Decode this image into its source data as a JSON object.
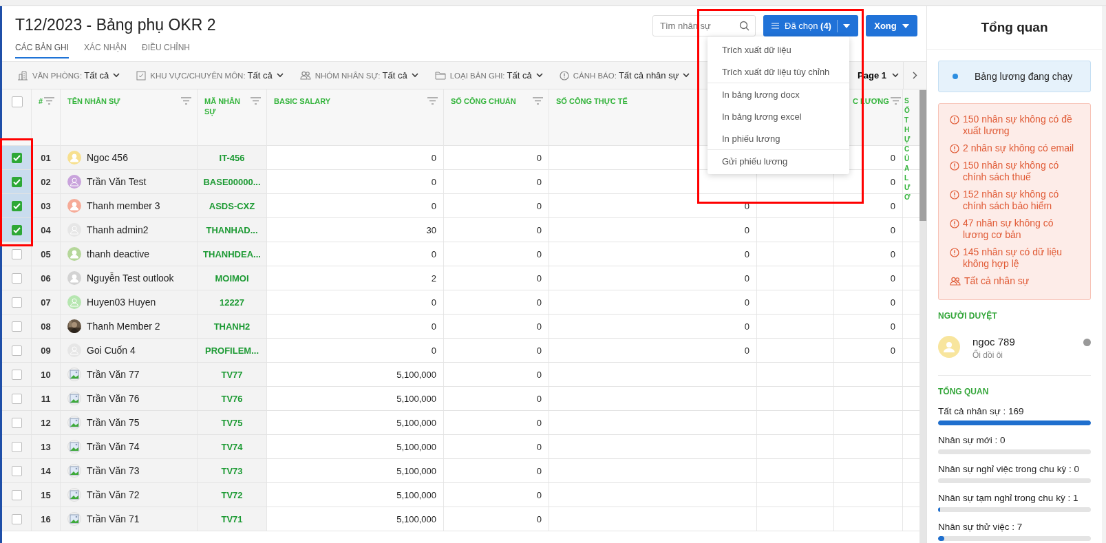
{
  "page": {
    "title": "T12/2023 - Bảng phụ OKR 2",
    "tabs": [
      {
        "label": "CÁC BẢN GHI",
        "selected": true
      },
      {
        "label": "XÁC NHẬN",
        "selected": false
      },
      {
        "label": "ĐIỀU CHỈNH",
        "selected": false
      }
    ]
  },
  "search": {
    "placeholder": "Tìm nhân sự"
  },
  "selected_button": {
    "label": "Đã chọn",
    "count": "(4)"
  },
  "done_button": {
    "label": "Xong"
  },
  "menu": {
    "groups": [
      [
        {
          "label": "Trích xuất dữ liệu"
        },
        {
          "label": "Trích xuất dữ liệu tùy chỉnh"
        }
      ],
      [
        {
          "label": "In bảng lương docx"
        },
        {
          "label": "In bảng lương excel"
        },
        {
          "label": "In phiếu lương"
        }
      ],
      [
        {
          "label": "Gửi phiếu lương"
        }
      ]
    ]
  },
  "filters": [
    {
      "kind": "office",
      "label": "VĂN PHÒNG:",
      "value": "Tất cả"
    },
    {
      "kind": "area",
      "label": "KHU VỰC/CHUYÊN MÔN:",
      "value": "Tất cả"
    },
    {
      "kind": "group",
      "label": "NHÓM NHÂN SỰ:",
      "value": "Tất cả"
    },
    {
      "kind": "type",
      "label": "LOẠI BẢN GHI:",
      "value": "Tất cả"
    },
    {
      "kind": "warning",
      "label": "CẢNH BÁO:",
      "value": "Tất cả nhân sự"
    }
  ],
  "pager": {
    "label": "Page 1"
  },
  "table": {
    "select_all_checked": false,
    "columns": [
      {
        "label": "#",
        "filter": true
      },
      {
        "label": "TÊN NHÂN SỰ",
        "filter": true
      },
      {
        "label": "MÃ NHÂN SỰ",
        "filter": true
      },
      {
        "label": "BASIC SALARY",
        "filter": true
      },
      {
        "label": "SỐ CÔNG CHUẨN",
        "filter": true
      },
      {
        "label": "SỐ CÔNG THỰC TẾ",
        "filter": false
      },
      {},
      {
        "label": "C LƯƠNG",
        "filter": true
      },
      {
        "label": "SỐ THỰ CỦA LƯƠ",
        "filter": false
      }
    ],
    "rows": [
      {
        "selected": true,
        "no": "01",
        "name": "Ngoc 456",
        "avatar": {
          "kind": "person",
          "color": "#f7e08f"
        },
        "code": "IT-456",
        "basic_salary": "0",
        "so_cong_chuan": "0",
        "c_luong": "0"
      },
      {
        "selected": true,
        "no": "02",
        "name": "Trần Văn Test",
        "avatar": {
          "kind": "outline",
          "color": "#c9a3dc"
        },
        "code": "BASE00000...",
        "basic_salary": "0",
        "so_cong_chuan": "0",
        "c_luong": "0"
      },
      {
        "selected": true,
        "no": "03",
        "name": "Thanh member 3",
        "avatar": {
          "kind": "person",
          "color": "#f6ab98"
        },
        "code": "ASDS-CXZ",
        "basic_salary": "0",
        "so_cong_chuan": "0",
        "so_cong_thuc_te": "0",
        "c_luong": "0"
      },
      {
        "selected": true,
        "no": "04",
        "name": "Thanh admin2",
        "avatar": {
          "kind": "outline",
          "color": "#e6e6e6"
        },
        "code": "THANHAD...",
        "basic_salary": "30",
        "so_cong_chuan": "0",
        "so_cong_thuc_te": "0",
        "c_luong": "0"
      },
      {
        "selected": false,
        "no": "05",
        "name": "thanh deactive",
        "avatar": {
          "kind": "person",
          "color": "#b5d79a"
        },
        "code": "THANHDEA...",
        "basic_salary": "0",
        "so_cong_chuan": "0",
        "so_cong_thuc_te": "0",
        "c_luong": "0"
      },
      {
        "selected": false,
        "no": "06",
        "name": "Nguyễn Test outlook",
        "avatar": {
          "kind": "person",
          "color": "#d3d3d3"
        },
        "code": "MOIMOI",
        "basic_salary": "2",
        "so_cong_chuan": "0",
        "so_cong_thuc_te": "0",
        "c_luong": "0"
      },
      {
        "selected": false,
        "no": "07",
        "name": "Huyen03 Huyen",
        "avatar": {
          "kind": "outline",
          "color": "#b6e6b0"
        },
        "code": "12227",
        "basic_salary": "0",
        "so_cong_chuan": "0",
        "so_cong_thuc_te": "0",
        "c_luong": "0"
      },
      {
        "selected": false,
        "no": "08",
        "name": "Thanh Member 2",
        "code": "THANH2",
        "basic_salary": "0",
        "so_cong_chuan": "0",
        "so_cong_thuc_te": "0",
        "c_luong": "0"
      },
      {
        "selected": false,
        "no": "09",
        "name": "Goi Cuốn 4",
        "avatar": {
          "kind": "outline",
          "color": "#e6e6e6"
        },
        "code": "PROFILEM...",
        "basic_salary": "0",
        "so_cong_chuan": "0",
        "so_cong_thuc_te": "0",
        "c_luong": "0"
      },
      {
        "selected": false,
        "no": "10",
        "name": "Trần Văn 77",
        "avatar": {
          "kind": "broken"
        },
        "code": "TV77",
        "basic_salary": "5,100,000",
        "so_cong_chuan": "0"
      },
      {
        "selected": false,
        "no": "11",
        "name": "Trần Văn 76",
        "avatar": {
          "kind": "broken"
        },
        "code": "TV76",
        "basic_salary": "5,100,000",
        "so_cong_chuan": "0"
      },
      {
        "selected": false,
        "no": "12",
        "name": "Trần Văn 75",
        "avatar": {
          "kind": "broken"
        },
        "code": "TV75",
        "basic_salary": "5,100,000",
        "so_cong_chuan": "0"
      },
      {
        "selected": false,
        "no": "13",
        "name": "Trần Văn 74",
        "avatar": {
          "kind": "broken"
        },
        "code": "TV74",
        "basic_salary": "5,100,000",
        "so_cong_chuan": "0"
      },
      {
        "selected": false,
        "no": "14",
        "name": "Trần Văn 73",
        "avatar": {
          "kind": "broken"
        },
        "code": "TV73",
        "basic_salary": "5,100,000",
        "so_cong_chuan": "0"
      },
      {
        "selected": false,
        "no": "15",
        "name": "Trần Văn 72",
        "avatar": {
          "kind": "broken"
        },
        "code": "TV72",
        "basic_salary": "5,100,000",
        "so_cong_chuan": "0"
      },
      {
        "selected": false,
        "no": "16",
        "name": "Trần Văn 71",
        "avatar": {
          "kind": "broken"
        },
        "code": "TV71",
        "basic_salary": "5,100,000",
        "so_cong_chuan": "0"
      }
    ]
  },
  "sidebar": {
    "title": "Tổng quan",
    "status": "Bảng lương đang chạy",
    "warnings": [
      {
        "kind": "warning",
        "text": "150 nhân sự không có đề xuất lương"
      },
      {
        "kind": "warning",
        "text": "2 nhân sự không có email"
      },
      {
        "kind": "warning",
        "text": "150 nhân sự không có chính sách thuế"
      },
      {
        "kind": "warning",
        "text": "152 nhân sự không có chính sách bảo hiểm"
      },
      {
        "kind": "warning",
        "text": "47 nhân sự không có lương cơ bản"
      },
      {
        "kind": "warning",
        "text": "145 nhân sự có dữ liệu không hợp lệ"
      },
      {
        "kind": "people",
        "text": "Tất cả nhân sự"
      }
    ],
    "approver_heading": "NGƯỜI DUYỆT",
    "approver": {
      "name": "ngoc 789",
      "note": "Ối dồi ôi"
    },
    "overview_heading": "TỔNG QUAN",
    "stats": [
      {
        "label": "Tất cả nhân sự : 169",
        "level": 1
      },
      {
        "label": "Nhân sự mới : 0",
        "level": 0
      },
      {
        "label": "Nhân sự nghỉ việc trong chu kỳ : 0",
        "level": 0
      },
      {
        "label": "Nhân sự tạm nghỉ trong chu kỳ : 1",
        "level": 0.006
      },
      {
        "label": "Nhân sự thử việc : 7",
        "level": 0.041
      }
    ]
  }
}
